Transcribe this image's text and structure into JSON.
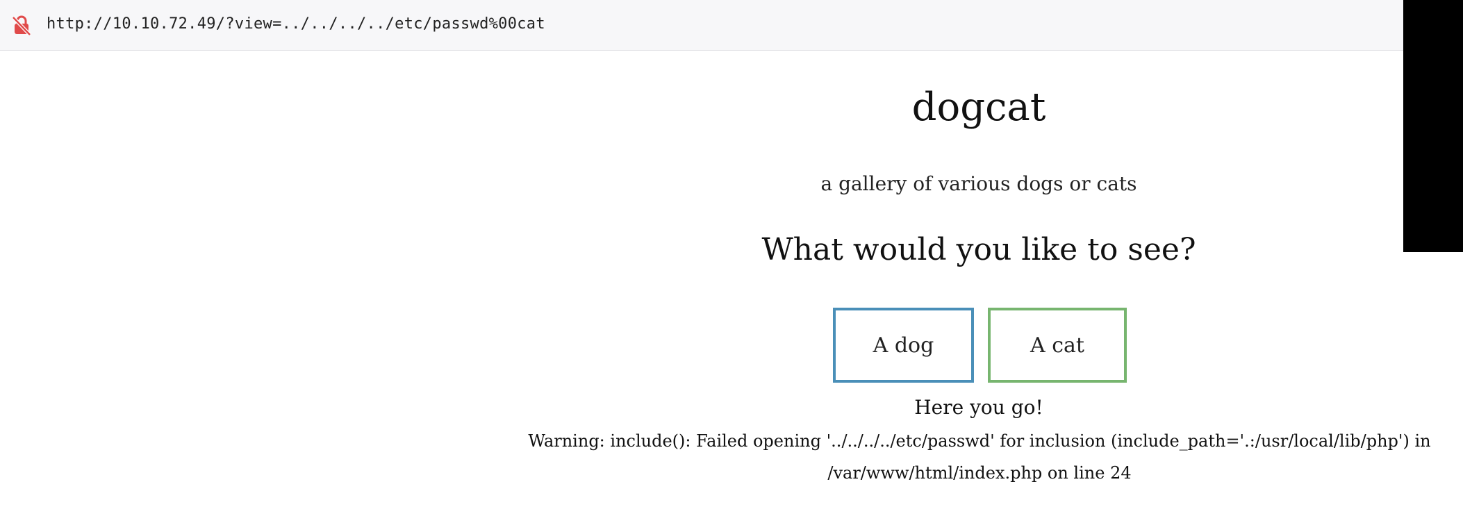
{
  "browser": {
    "url": "http://10.10.72.49/?view=../../../../etc/passwd%00cat",
    "lock_icon": "insecure-lock-icon",
    "lock_color": "#e04a4a"
  },
  "page": {
    "title": "dogcat",
    "tagline": "a gallery of various dogs or cats",
    "question": "What would you like to see?",
    "buttons": {
      "dog_label": "A dog",
      "cat_label": "A cat",
      "dog_color": "#4a8fb8",
      "cat_color": "#77b56f"
    },
    "result_text": "Here you go!",
    "warning_line1": "Warning: include(): Failed opening '../../../../etc/passwd' for inclusion (include_path='.:/usr/local/lib/php') in",
    "warning_line2": "/var/www/html/index.php on line 24"
  }
}
